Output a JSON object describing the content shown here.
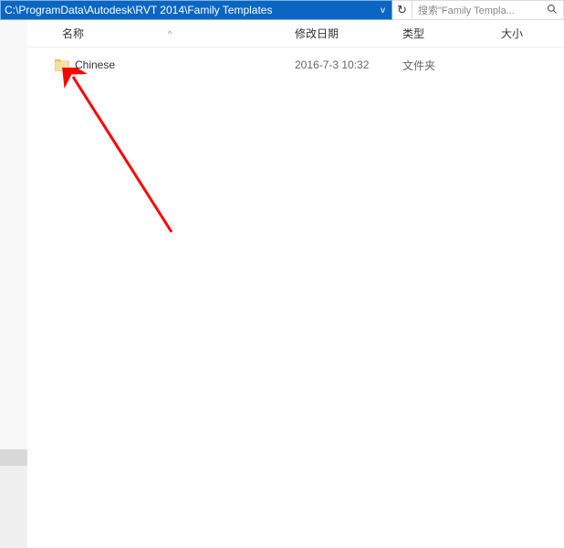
{
  "address_bar": {
    "path": "C:\\ProgramData\\Autodesk\\RVT 2014\\Family Templates"
  },
  "search": {
    "placeholder": "搜索\"Family Templa...",
    "icon_label": "search"
  },
  "refresh": {
    "label": "↻"
  },
  "columns": {
    "name": "名称",
    "date": "修改日期",
    "type": "类型",
    "size": "大小",
    "sort_indicator": "^"
  },
  "items": [
    {
      "name": "Chinese",
      "date": "2016-7-3 10:32",
      "type": "文件夹",
      "size": ""
    }
  ]
}
